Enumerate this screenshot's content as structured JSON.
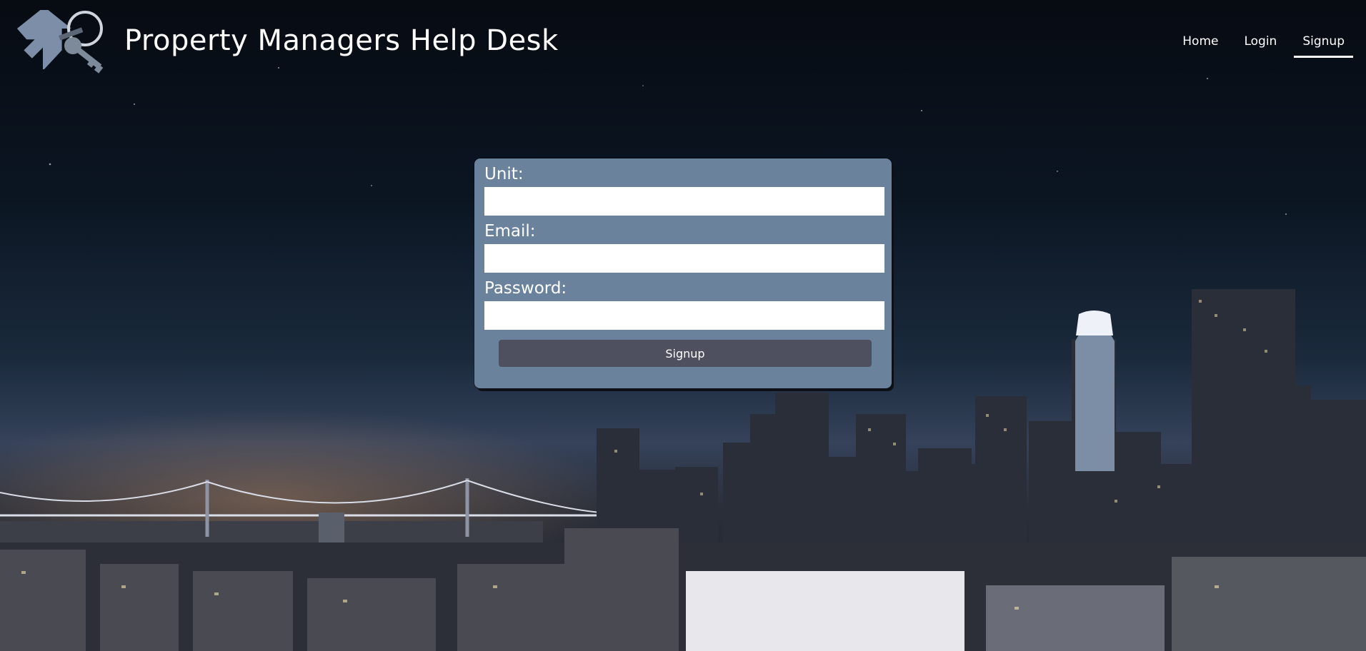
{
  "header": {
    "title": "Property Managers Help Desk",
    "logo_icon": "house-with-keys-icon"
  },
  "nav": {
    "items": [
      {
        "label": "Home",
        "active": false
      },
      {
        "label": "Login",
        "active": false
      },
      {
        "label": "Signup",
        "active": true
      }
    ]
  },
  "form": {
    "unit_label": "Unit:",
    "unit_value": "",
    "email_label": "Email:",
    "email_value": "",
    "password_label": "Password:",
    "password_value": "",
    "submit_label": "Signup"
  },
  "colors": {
    "card_background": "#6b829d",
    "button_background": "#4e5060",
    "text": "#ffffff"
  }
}
